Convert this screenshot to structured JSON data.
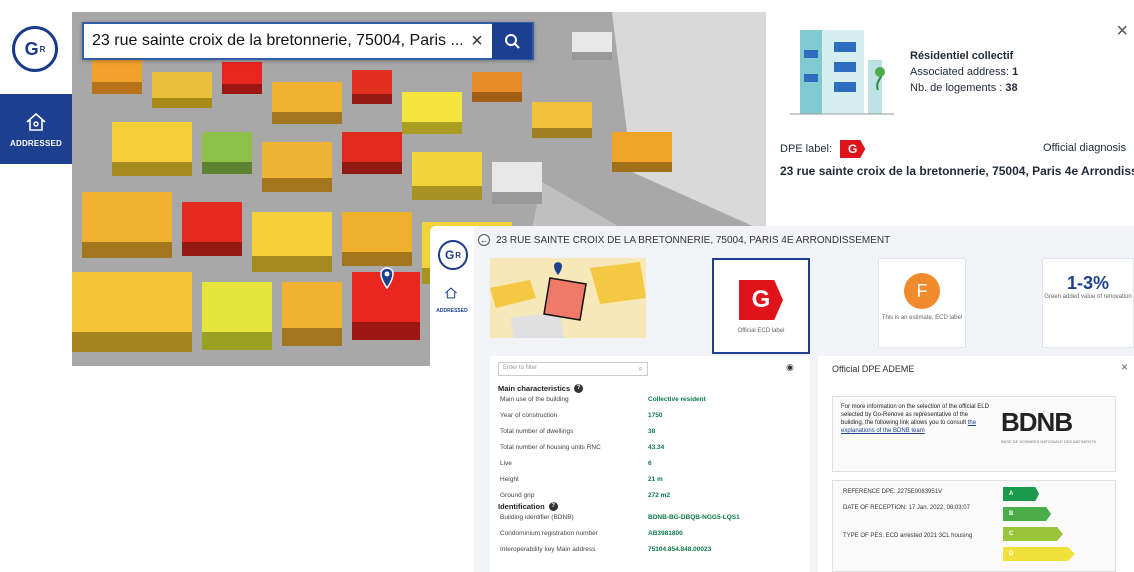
{
  "search": {
    "value": "23 rue sainte croix de la bretonnerie, 75004, Paris ..."
  },
  "logo": {
    "text": "G",
    "sup": "R"
  },
  "rail": {
    "addressed_label": "ADDRESSED"
  },
  "info": {
    "building_type": "Résidentiel collectif",
    "associated_label": "Associated address:",
    "associated_value": "1",
    "logements_label": "Nb. de logements :",
    "logements_value": "38",
    "dpe_label": "DPE label:",
    "dpe_value": "G",
    "official_diagnosis": "Official diagnosis",
    "address": "23 rue sainte croix de la bretonnerie, 75004, Paris 4e Arrondiss"
  },
  "panel": {
    "header": "23 RUE SAINTE CROIX DE LA BRETONNERIE, 75004, PARIS 4E ARRONDISSEMENT",
    "addressed_label": "ADDRESSED",
    "cards": [
      {
        "value": "G",
        "caption": "Official ECD label"
      },
      {
        "value": "F",
        "caption": "This is an estimate. ECD label"
      },
      {
        "value": "1-3%",
        "caption": "Green added value of renovation"
      }
    ],
    "filter_placeholder": "Enter to filter",
    "sections": {
      "main": "Main characteristics",
      "main_badge": "?",
      "ident": "Identification",
      "ident_badge": "?"
    },
    "main_rows": [
      {
        "k": "Main use of the building",
        "v": "Collective resident"
      },
      {
        "k": "Year of construction",
        "v": "1750"
      },
      {
        "k": "Total number of dwellings",
        "v": "38"
      },
      {
        "k": "Total number of housing units RNC",
        "v": "43.34"
      },
      {
        "k": "Live",
        "v": "6"
      },
      {
        "k": "Height",
        "v": "21 m"
      },
      {
        "k": "Ground grip",
        "v": "272 m2"
      }
    ],
    "ident_rows": [
      {
        "k": "Building identifier (BDNB)",
        "v": "BDNB-BG-DBQB-NGG5-LQS1"
      },
      {
        "k": "Condominium registration number",
        "v": "AB3981800"
      },
      {
        "k": "Interoperability key Main address",
        "v": "75104.854.848.00023"
      }
    ]
  },
  "ademe": {
    "title": "Official DPE ADEME",
    "message": "For more information on the selection of the official ELD selected by Go-Renove as representative of the building, the following link allows you to consult",
    "link": "the explanations of the BDNB team",
    "logo": "BDNB",
    "logo_sub": "BASE DE DONNÉES NATIONALE DES BÂTIMENTS",
    "ref": "REFERENCE DPE: 2275E0083951V",
    "date": "DATE OF RECEPTION: 17 Jan. 2022, 08:03:07",
    "type": "TYPE OF PES: ECD arrested 2021 3CL housing",
    "bands": [
      "A",
      "B",
      "C",
      "D"
    ],
    "band_colors": [
      "#1a9a4a",
      "#4aad4a",
      "#9ac43a",
      "#f0e23a"
    ]
  },
  "colors": {
    "primary": "#1c3f8f",
    "dpe_g": "#e0131a",
    "dpe_f": "#f08a2c"
  }
}
